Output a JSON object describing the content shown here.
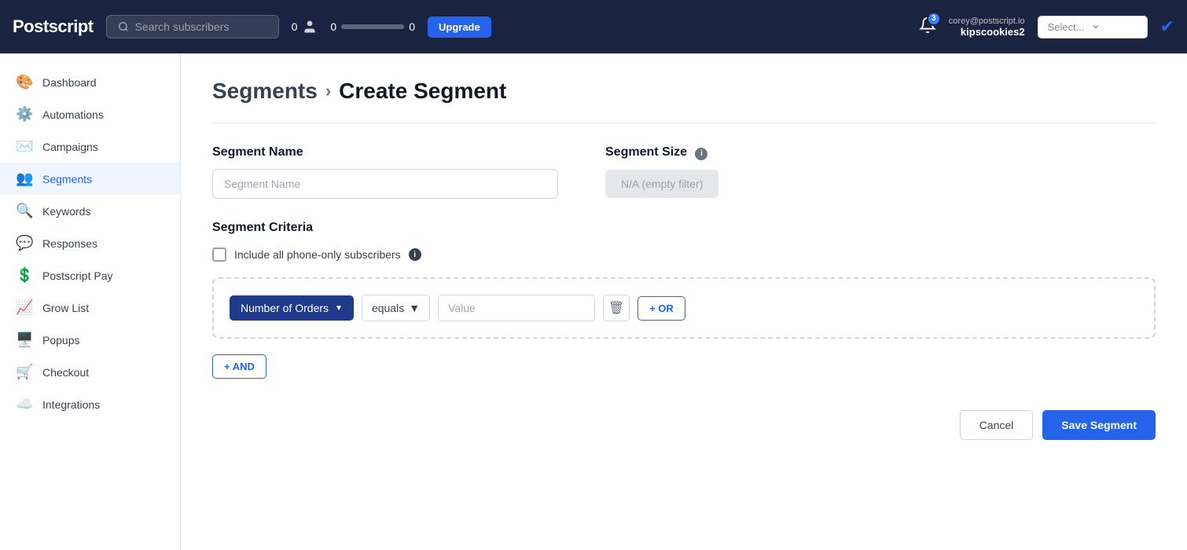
{
  "topnav": {
    "logo": "Postscript",
    "search_placeholder": "Search subscribers",
    "stat1_count": "0",
    "stat2_count": "0",
    "stat3_count": "0",
    "upgrade_label": "Upgrade",
    "bell_badge": "3",
    "user_email": "corey@postscript.io",
    "user_shop": "kipscookies2",
    "select_placeholder": "Select...",
    "checkbox_icon": "✔"
  },
  "sidebar": {
    "items": [
      {
        "id": "dashboard",
        "label": "Dashboard",
        "icon": "🎨"
      },
      {
        "id": "automations",
        "label": "Automations",
        "icon": "⚙️"
      },
      {
        "id": "campaigns",
        "label": "Campaigns",
        "icon": "✉️"
      },
      {
        "id": "segments",
        "label": "Segments",
        "icon": "👥",
        "active": true
      },
      {
        "id": "keywords",
        "label": "Keywords",
        "icon": "🔍"
      },
      {
        "id": "responses",
        "label": "Responses",
        "icon": "💬"
      },
      {
        "id": "postscript-pay",
        "label": "Postscript Pay",
        "icon": "💲"
      },
      {
        "id": "grow-list",
        "label": "Grow List",
        "icon": "📈"
      },
      {
        "id": "popups",
        "label": "Popups",
        "icon": "🖥️"
      },
      {
        "id": "checkout",
        "label": "Checkout",
        "icon": "🛒"
      },
      {
        "id": "integrations",
        "label": "Integrations",
        "icon": "☁️"
      }
    ]
  },
  "page": {
    "breadcrumb_parent": "Segments",
    "breadcrumb_sep": "›",
    "breadcrumb_current": "Create Segment",
    "segment_name_label": "Segment Name",
    "segment_name_placeholder": "Segment Name",
    "segment_size_label": "Segment Size",
    "segment_size_info": "i",
    "segment_size_value": "N/A (empty filter)",
    "criteria_label": "Segment Criteria",
    "phone_only_label": "Include all phone-only subscribers",
    "phone_info": "i",
    "criteria_filter_label": "Number of Orders",
    "criteria_operator_label": "equals",
    "criteria_value_placeholder": "Value",
    "delete_icon": "🗑",
    "or_btn_label": "+ OR",
    "and_btn_label": "+ AND",
    "cancel_label": "Cancel",
    "save_label": "Save Segment"
  }
}
